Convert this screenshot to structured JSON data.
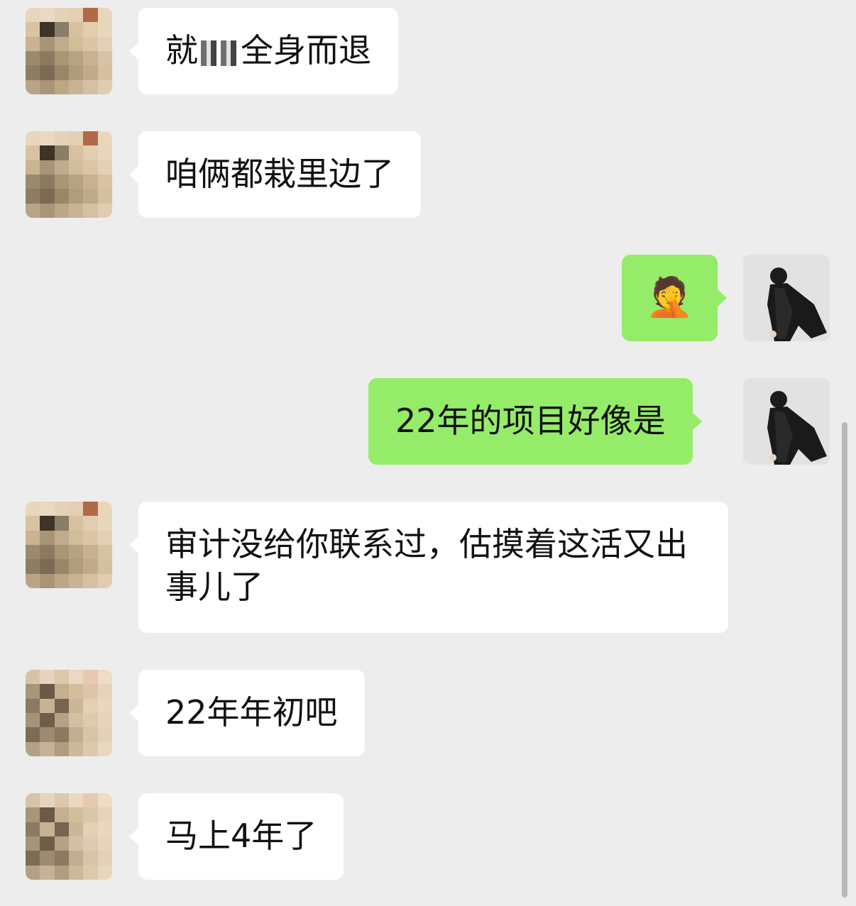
{
  "messages": [
    {
      "side": "left",
      "text_before": "就",
      "redacted": true,
      "text_after": "全身而退"
    },
    {
      "side": "left",
      "text": "咱俩都栽里边了"
    },
    {
      "side": "right",
      "emoji": "facepalm-crying-laughing-emoji",
      "text": "🤦"
    },
    {
      "side": "right",
      "text": "22年的项目好像是"
    },
    {
      "side": "left",
      "text": "审计没给你联系过，估摸着这活又出事儿了"
    },
    {
      "side": "left",
      "text": "22年年初吧"
    },
    {
      "side": "left",
      "text": "马上4年了"
    }
  ],
  "colors": {
    "background": "#ededed",
    "left_bubble": "#ffffff",
    "right_bubble": "#95ec69"
  }
}
